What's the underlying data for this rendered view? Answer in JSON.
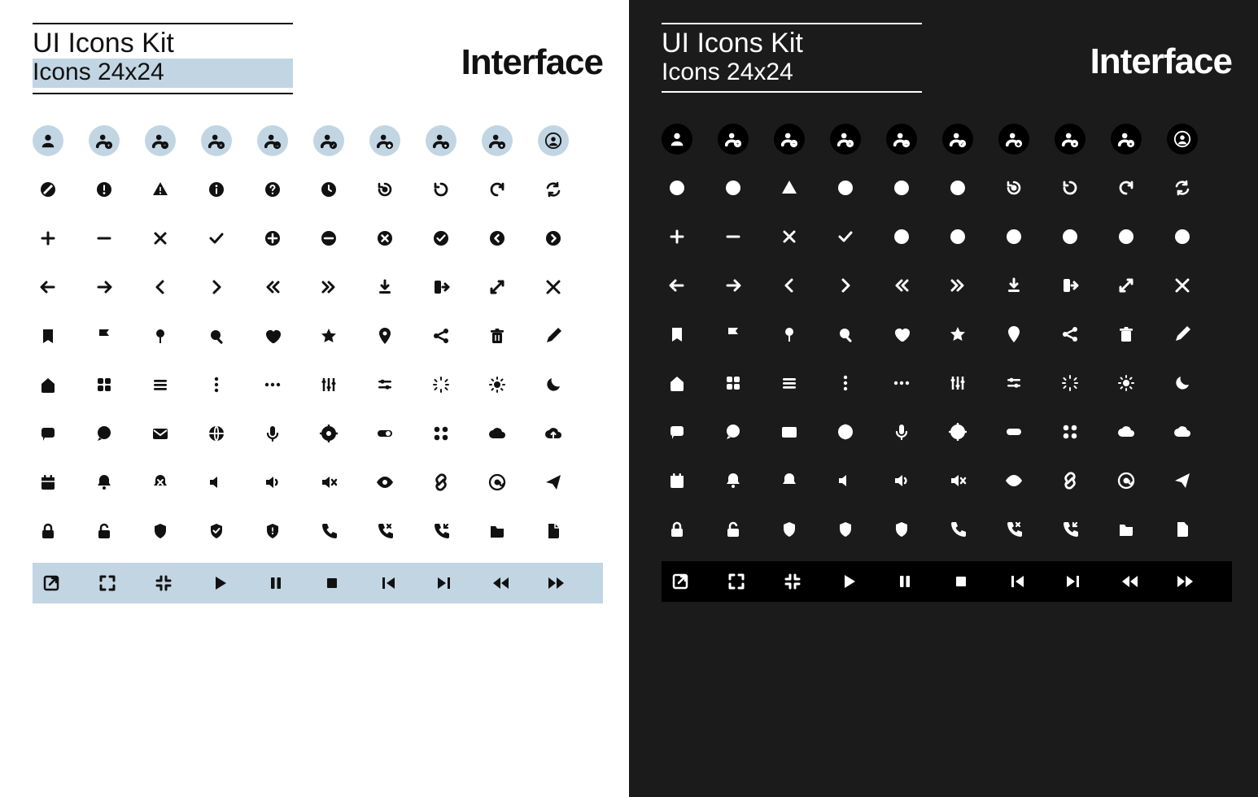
{
  "light": {
    "title": "UI Icons Kit",
    "subtitle": "Icons 24x24",
    "category": "Interface",
    "accent": "#c2d5e3",
    "fg": "#111111",
    "bg": "#ffffff"
  },
  "dark": {
    "title": "UI Icons Kit",
    "subtitle": "Icons 24x24",
    "category": "Interface",
    "fg": "#ffffff",
    "bg": "#1b1b1b"
  },
  "icon_grid": {
    "columns": 10,
    "rows": [
      [
        "user",
        "user-add",
        "user-remove",
        "user-x",
        "user-arrow",
        "user-check",
        "user-shield",
        "user-lock",
        "users",
        "user-circle"
      ],
      [
        "block",
        "alert-circle",
        "alert-triangle",
        "info",
        "question",
        "clock",
        "history",
        "rotate-ccw",
        "rotate-cw",
        "refresh"
      ],
      [
        "plus",
        "minus",
        "x",
        "check",
        "plus-circle",
        "minus-circle",
        "x-circle",
        "check-badge",
        "chevron-left-circle",
        "chevron-right-circle"
      ],
      [
        "arrow-left",
        "arrow-right",
        "chevron-left",
        "chevron-right",
        "chevrons-left",
        "chevrons-right",
        "download",
        "logout",
        "expand",
        "shrink"
      ],
      [
        "bookmark",
        "flag",
        "pin",
        "search",
        "heart",
        "star",
        "location",
        "share",
        "trash",
        "edit"
      ],
      [
        "home",
        "grid",
        "menu",
        "more-vertical",
        "more-horizontal",
        "sliders",
        "filters",
        "loading",
        "sun",
        "moon"
      ],
      [
        "message-square",
        "chat",
        "mail",
        "globe",
        "mic",
        "settings",
        "toggle",
        "apps",
        "cloud",
        "cloud-upload"
      ],
      [
        "calendar",
        "bell",
        "bell-off",
        "volume-low",
        "volume",
        "volume-mute",
        "eye",
        "link",
        "at",
        "send"
      ],
      [
        "lock",
        "unlock",
        "shield",
        "shield-check",
        "shield-alert",
        "phone",
        "phone-x",
        "phone-incoming",
        "folder",
        "file"
      ],
      [
        "external",
        "fullscreen",
        "exit-fullscreen",
        "play",
        "pause",
        "stop",
        "skip-back",
        "skip-forward",
        "rewind",
        "fast-forward"
      ]
    ]
  }
}
